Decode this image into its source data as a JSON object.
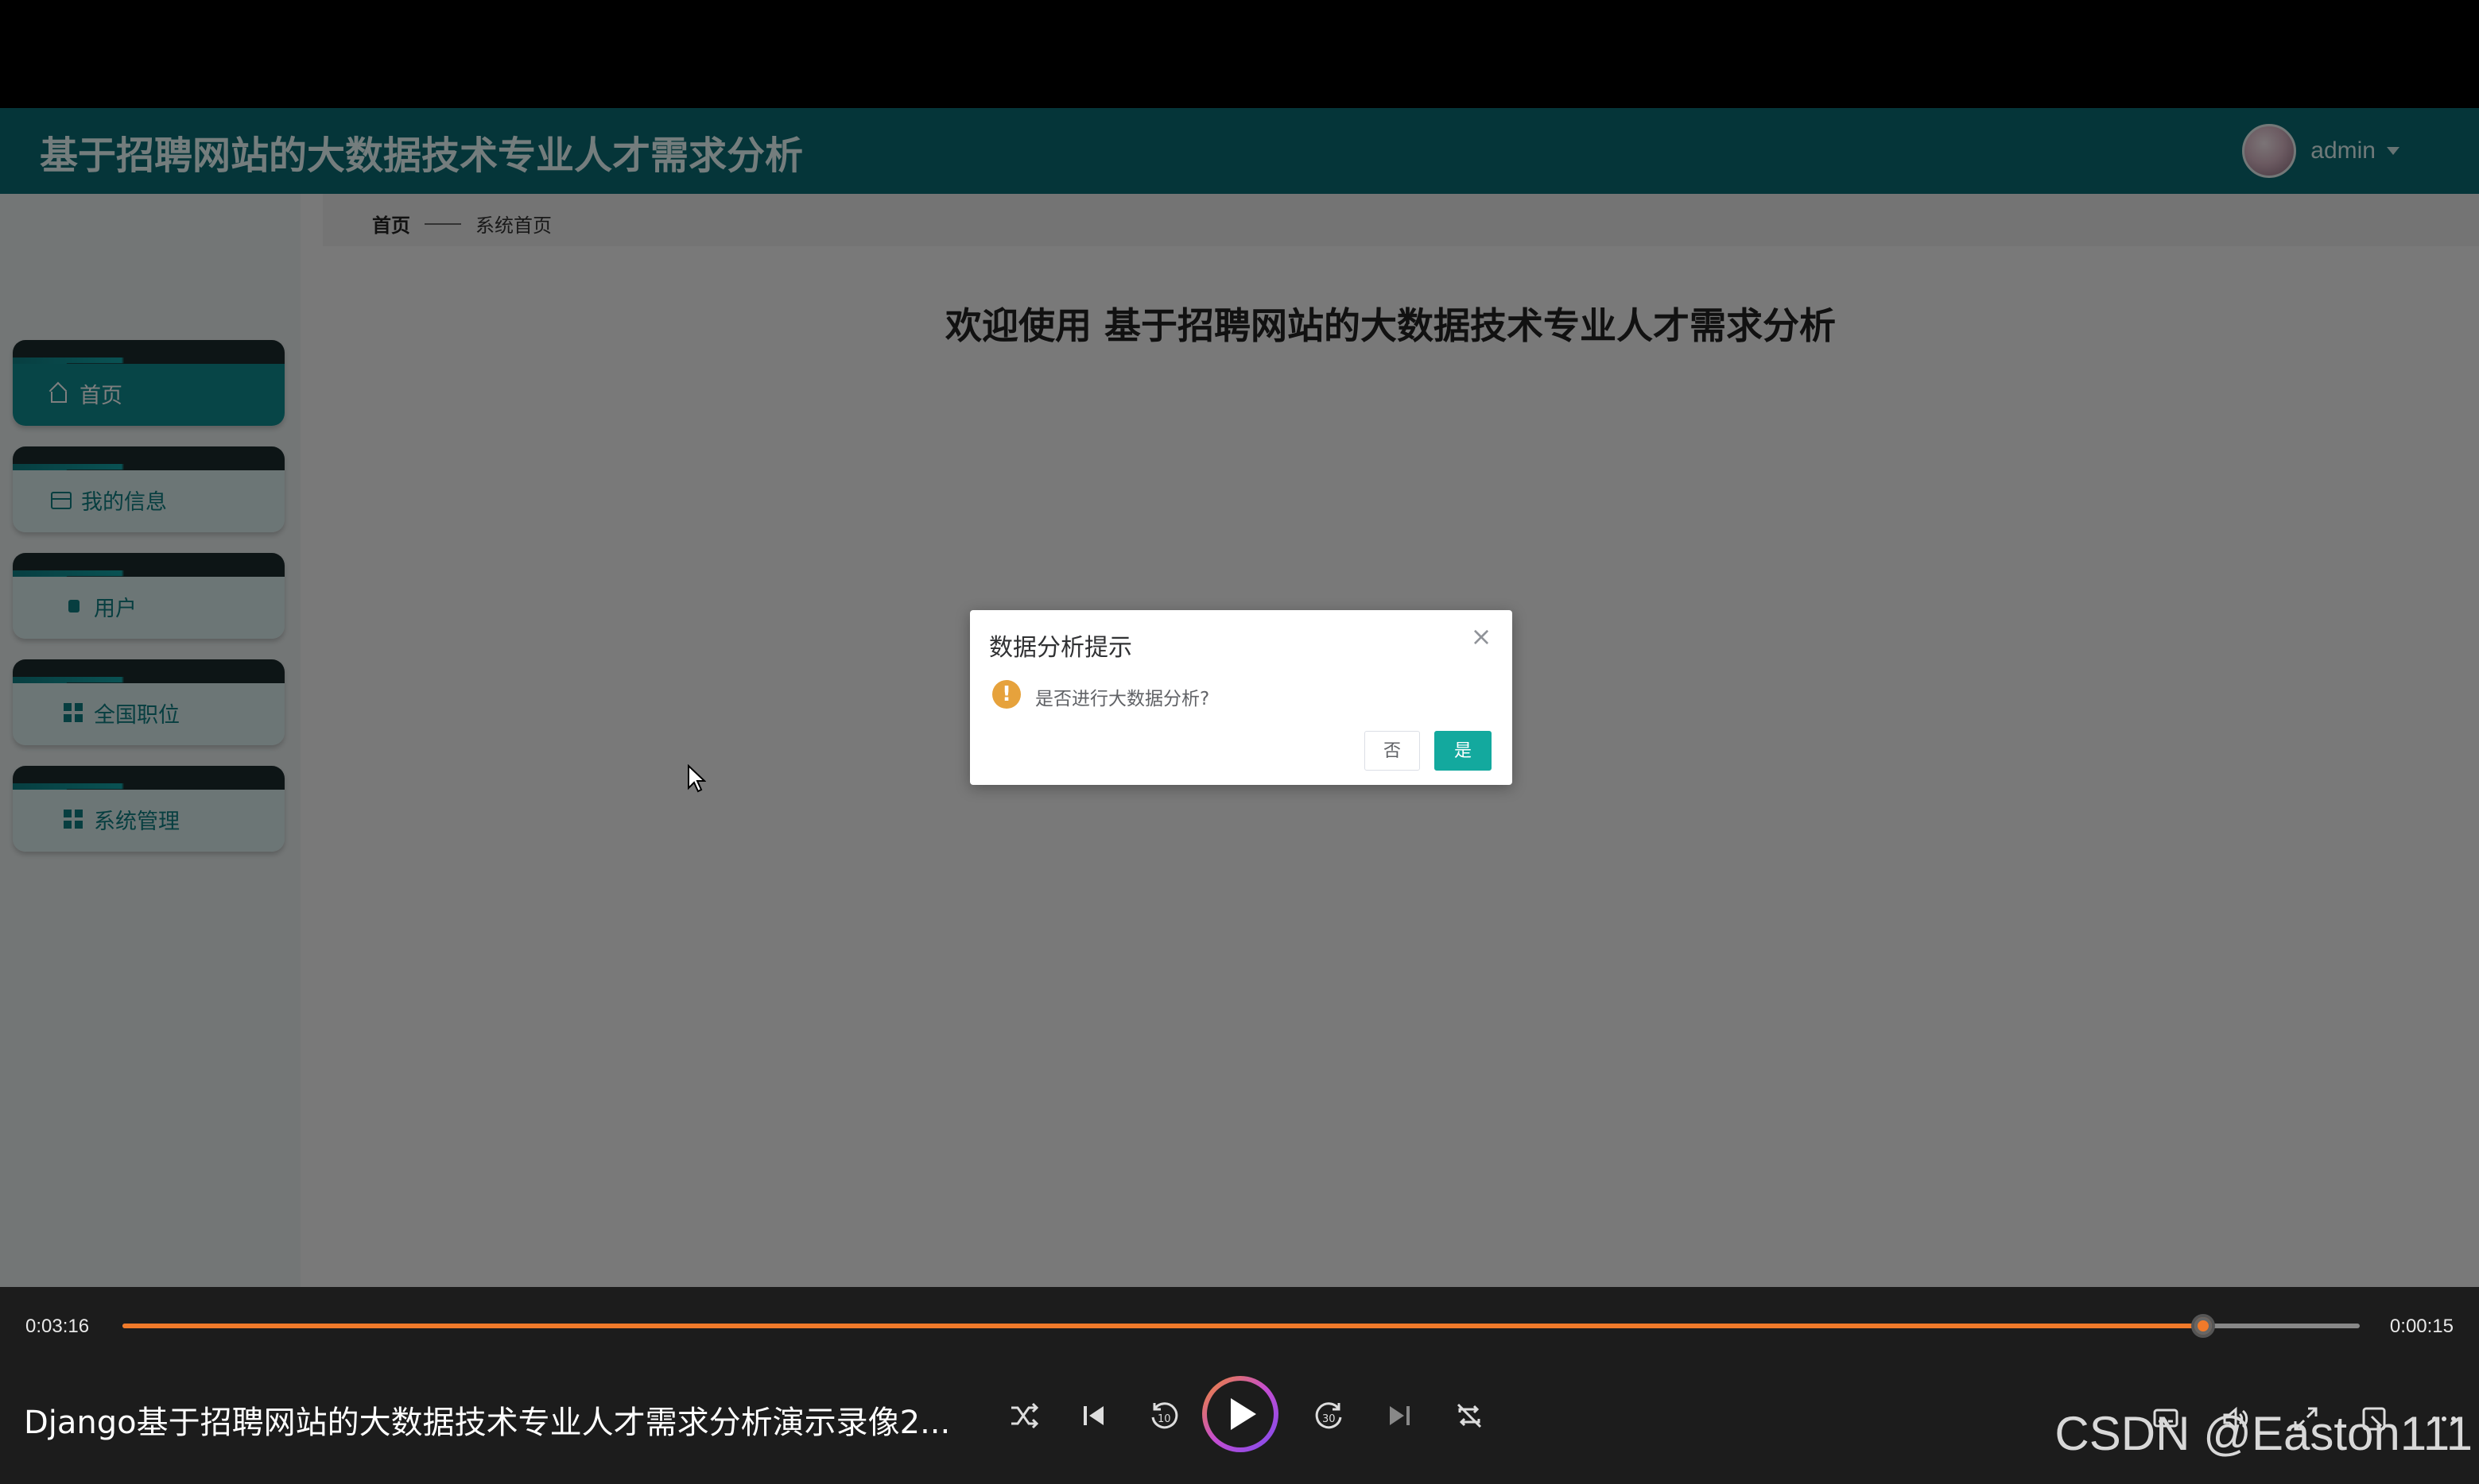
{
  "app": {
    "title": "基于招聘网站的大数据技术专业人才需求分析",
    "user": {
      "name": "admin"
    },
    "sidebar": {
      "items": [
        {
          "label": "首页",
          "icon": "home-icon",
          "active": true
        },
        {
          "label": "我的信息",
          "icon": "card-icon",
          "active": false
        },
        {
          "label": "用户",
          "icon": "user-icon",
          "active": false
        },
        {
          "label": "全国职位",
          "icon": "grid-icon",
          "active": false
        },
        {
          "label": "系统管理",
          "icon": "grid-icon",
          "active": false
        }
      ]
    },
    "breadcrumb": {
      "home": "首页",
      "current": "系统首页"
    },
    "welcome": "欢迎使用 基于招聘网站的大数据技术专业人才需求分析",
    "colors": {
      "header": "#0b6b72",
      "accent": "#13a99e",
      "warning": "#e6a23c"
    }
  },
  "dialog": {
    "title": "数据分析提示",
    "message": "是否进行大数据分析?",
    "cancel_label": "否",
    "confirm_label": "是",
    "close_glyph": "×",
    "warning_glyph": "!"
  },
  "player": {
    "elapsed": "0:03:16",
    "remaining": "0:00:15",
    "progress": 0.93,
    "title": "Django基于招聘网站的大数据技术专业人才需求分析演示录像2...",
    "watermark": "CSDN @Easton111",
    "accent": "#f07a2a"
  }
}
